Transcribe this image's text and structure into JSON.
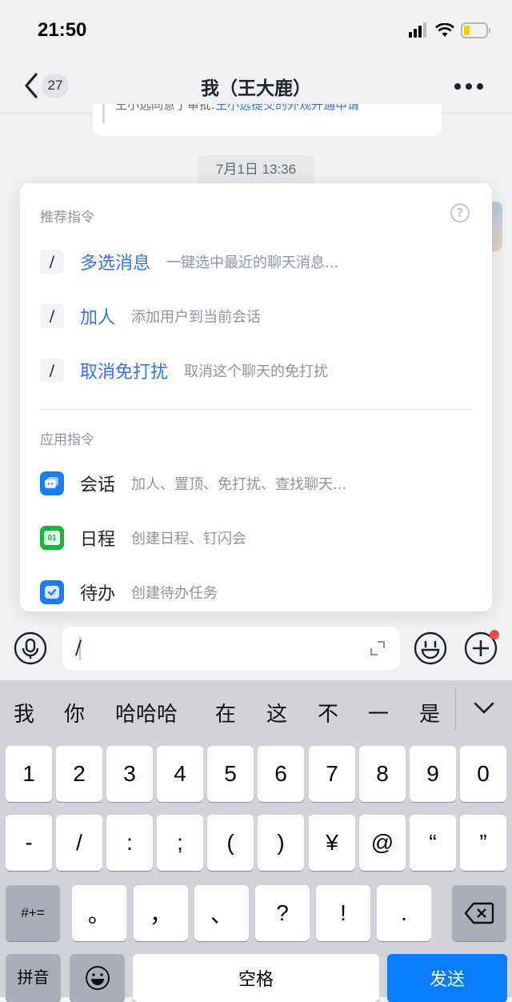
{
  "status_bar": {
    "time": "21:50",
    "battery_level": 0.2
  },
  "nav": {
    "unread_count": "27",
    "title": "我（王大鹿）"
  },
  "chat": {
    "partial_message": {
      "prefix": "王小选同意了审批:",
      "link": "王小选提交的外观开通申请"
    },
    "timestamp": "7月1日 13:36"
  },
  "command_popup": {
    "recommended_title": "推荐指令",
    "recommended": [
      {
        "slash": "/",
        "name": "多选消息",
        "desc": "一键选中最近的聊天消息..."
      },
      {
        "slash": "/",
        "name": "加人",
        "desc": "添加用户到当前会话"
      },
      {
        "slash": "/",
        "name": "取消免打扰",
        "desc": "取消这个聊天的免打扰"
      }
    ],
    "app_title": "应用指令",
    "apps": [
      {
        "icon": "chat-bubble-icon",
        "name": "会话",
        "desc": "加人、置顶、免打扰、查找聊天...",
        "color": "#1a7dff"
      },
      {
        "icon": "calendar-icon",
        "name": "日程",
        "desc": "创建日程、钉闪会",
        "color": "#13b83a",
        "icon_text": "01"
      },
      {
        "icon": "todo-check-icon",
        "name": "待办",
        "desc": "创建待办任务",
        "color": "#1a7dff"
      }
    ]
  },
  "input": {
    "value": "/"
  },
  "keyboard": {
    "candidates": [
      "我",
      "你",
      "哈哈哈",
      "在",
      "这",
      "不",
      "一",
      "是"
    ],
    "row1": [
      "1",
      "2",
      "3",
      "4",
      "5",
      "6",
      "7",
      "8",
      "9",
      "0"
    ],
    "row2": [
      "-",
      "/",
      ":",
      ";",
      "(",
      ")",
      "¥",
      "@",
      "“",
      "”"
    ],
    "row3_left": "#+=",
    "row3": [
      "。",
      "，",
      "、",
      "?",
      "!",
      "."
    ],
    "pinyin": "拼音",
    "space": "空格",
    "send": "发送"
  }
}
